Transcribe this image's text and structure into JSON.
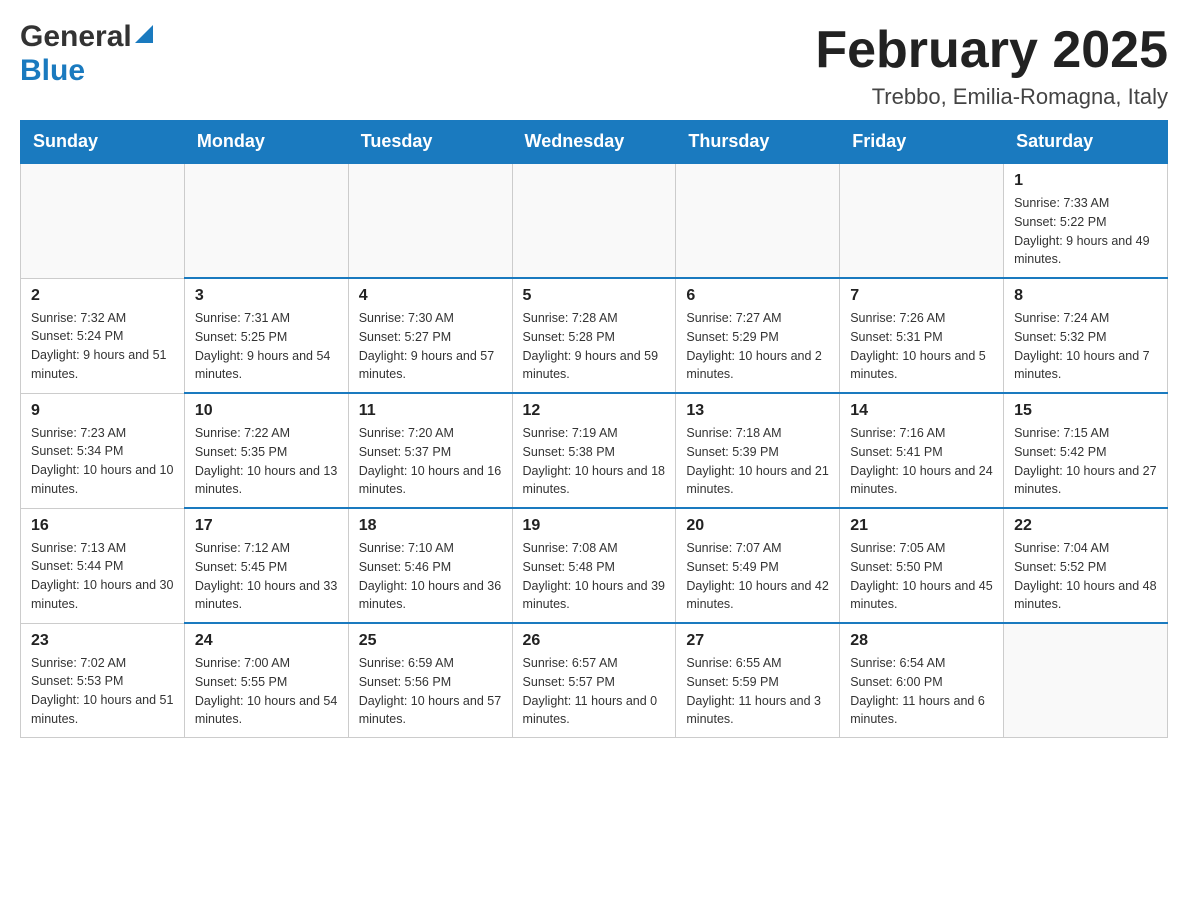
{
  "header": {
    "logo_general": "General",
    "logo_blue": "Blue",
    "month_title": "February 2025",
    "location": "Trebbo, Emilia-Romagna, Italy"
  },
  "days_of_week": [
    "Sunday",
    "Monday",
    "Tuesday",
    "Wednesday",
    "Thursday",
    "Friday",
    "Saturday"
  ],
  "weeks": [
    {
      "days": [
        {
          "number": "",
          "info": ""
        },
        {
          "number": "",
          "info": ""
        },
        {
          "number": "",
          "info": ""
        },
        {
          "number": "",
          "info": ""
        },
        {
          "number": "",
          "info": ""
        },
        {
          "number": "",
          "info": ""
        },
        {
          "number": "1",
          "info": "Sunrise: 7:33 AM\nSunset: 5:22 PM\nDaylight: 9 hours and 49 minutes."
        }
      ]
    },
    {
      "days": [
        {
          "number": "2",
          "info": "Sunrise: 7:32 AM\nSunset: 5:24 PM\nDaylight: 9 hours and 51 minutes."
        },
        {
          "number": "3",
          "info": "Sunrise: 7:31 AM\nSunset: 5:25 PM\nDaylight: 9 hours and 54 minutes."
        },
        {
          "number": "4",
          "info": "Sunrise: 7:30 AM\nSunset: 5:27 PM\nDaylight: 9 hours and 57 minutes."
        },
        {
          "number": "5",
          "info": "Sunrise: 7:28 AM\nSunset: 5:28 PM\nDaylight: 9 hours and 59 minutes."
        },
        {
          "number": "6",
          "info": "Sunrise: 7:27 AM\nSunset: 5:29 PM\nDaylight: 10 hours and 2 minutes."
        },
        {
          "number": "7",
          "info": "Sunrise: 7:26 AM\nSunset: 5:31 PM\nDaylight: 10 hours and 5 minutes."
        },
        {
          "number": "8",
          "info": "Sunrise: 7:24 AM\nSunset: 5:32 PM\nDaylight: 10 hours and 7 minutes."
        }
      ]
    },
    {
      "days": [
        {
          "number": "9",
          "info": "Sunrise: 7:23 AM\nSunset: 5:34 PM\nDaylight: 10 hours and 10 minutes."
        },
        {
          "number": "10",
          "info": "Sunrise: 7:22 AM\nSunset: 5:35 PM\nDaylight: 10 hours and 13 minutes."
        },
        {
          "number": "11",
          "info": "Sunrise: 7:20 AM\nSunset: 5:37 PM\nDaylight: 10 hours and 16 minutes."
        },
        {
          "number": "12",
          "info": "Sunrise: 7:19 AM\nSunset: 5:38 PM\nDaylight: 10 hours and 18 minutes."
        },
        {
          "number": "13",
          "info": "Sunrise: 7:18 AM\nSunset: 5:39 PM\nDaylight: 10 hours and 21 minutes."
        },
        {
          "number": "14",
          "info": "Sunrise: 7:16 AM\nSunset: 5:41 PM\nDaylight: 10 hours and 24 minutes."
        },
        {
          "number": "15",
          "info": "Sunrise: 7:15 AM\nSunset: 5:42 PM\nDaylight: 10 hours and 27 minutes."
        }
      ]
    },
    {
      "days": [
        {
          "number": "16",
          "info": "Sunrise: 7:13 AM\nSunset: 5:44 PM\nDaylight: 10 hours and 30 minutes."
        },
        {
          "number": "17",
          "info": "Sunrise: 7:12 AM\nSunset: 5:45 PM\nDaylight: 10 hours and 33 minutes."
        },
        {
          "number": "18",
          "info": "Sunrise: 7:10 AM\nSunset: 5:46 PM\nDaylight: 10 hours and 36 minutes."
        },
        {
          "number": "19",
          "info": "Sunrise: 7:08 AM\nSunset: 5:48 PM\nDaylight: 10 hours and 39 minutes."
        },
        {
          "number": "20",
          "info": "Sunrise: 7:07 AM\nSunset: 5:49 PM\nDaylight: 10 hours and 42 minutes."
        },
        {
          "number": "21",
          "info": "Sunrise: 7:05 AM\nSunset: 5:50 PM\nDaylight: 10 hours and 45 minutes."
        },
        {
          "number": "22",
          "info": "Sunrise: 7:04 AM\nSunset: 5:52 PM\nDaylight: 10 hours and 48 minutes."
        }
      ]
    },
    {
      "days": [
        {
          "number": "23",
          "info": "Sunrise: 7:02 AM\nSunset: 5:53 PM\nDaylight: 10 hours and 51 minutes."
        },
        {
          "number": "24",
          "info": "Sunrise: 7:00 AM\nSunset: 5:55 PM\nDaylight: 10 hours and 54 minutes."
        },
        {
          "number": "25",
          "info": "Sunrise: 6:59 AM\nSunset: 5:56 PM\nDaylight: 10 hours and 57 minutes."
        },
        {
          "number": "26",
          "info": "Sunrise: 6:57 AM\nSunset: 5:57 PM\nDaylight: 11 hours and 0 minutes."
        },
        {
          "number": "27",
          "info": "Sunrise: 6:55 AM\nSunset: 5:59 PM\nDaylight: 11 hours and 3 minutes."
        },
        {
          "number": "28",
          "info": "Sunrise: 6:54 AM\nSunset: 6:00 PM\nDaylight: 11 hours and 6 minutes."
        },
        {
          "number": "",
          "info": ""
        }
      ]
    }
  ]
}
